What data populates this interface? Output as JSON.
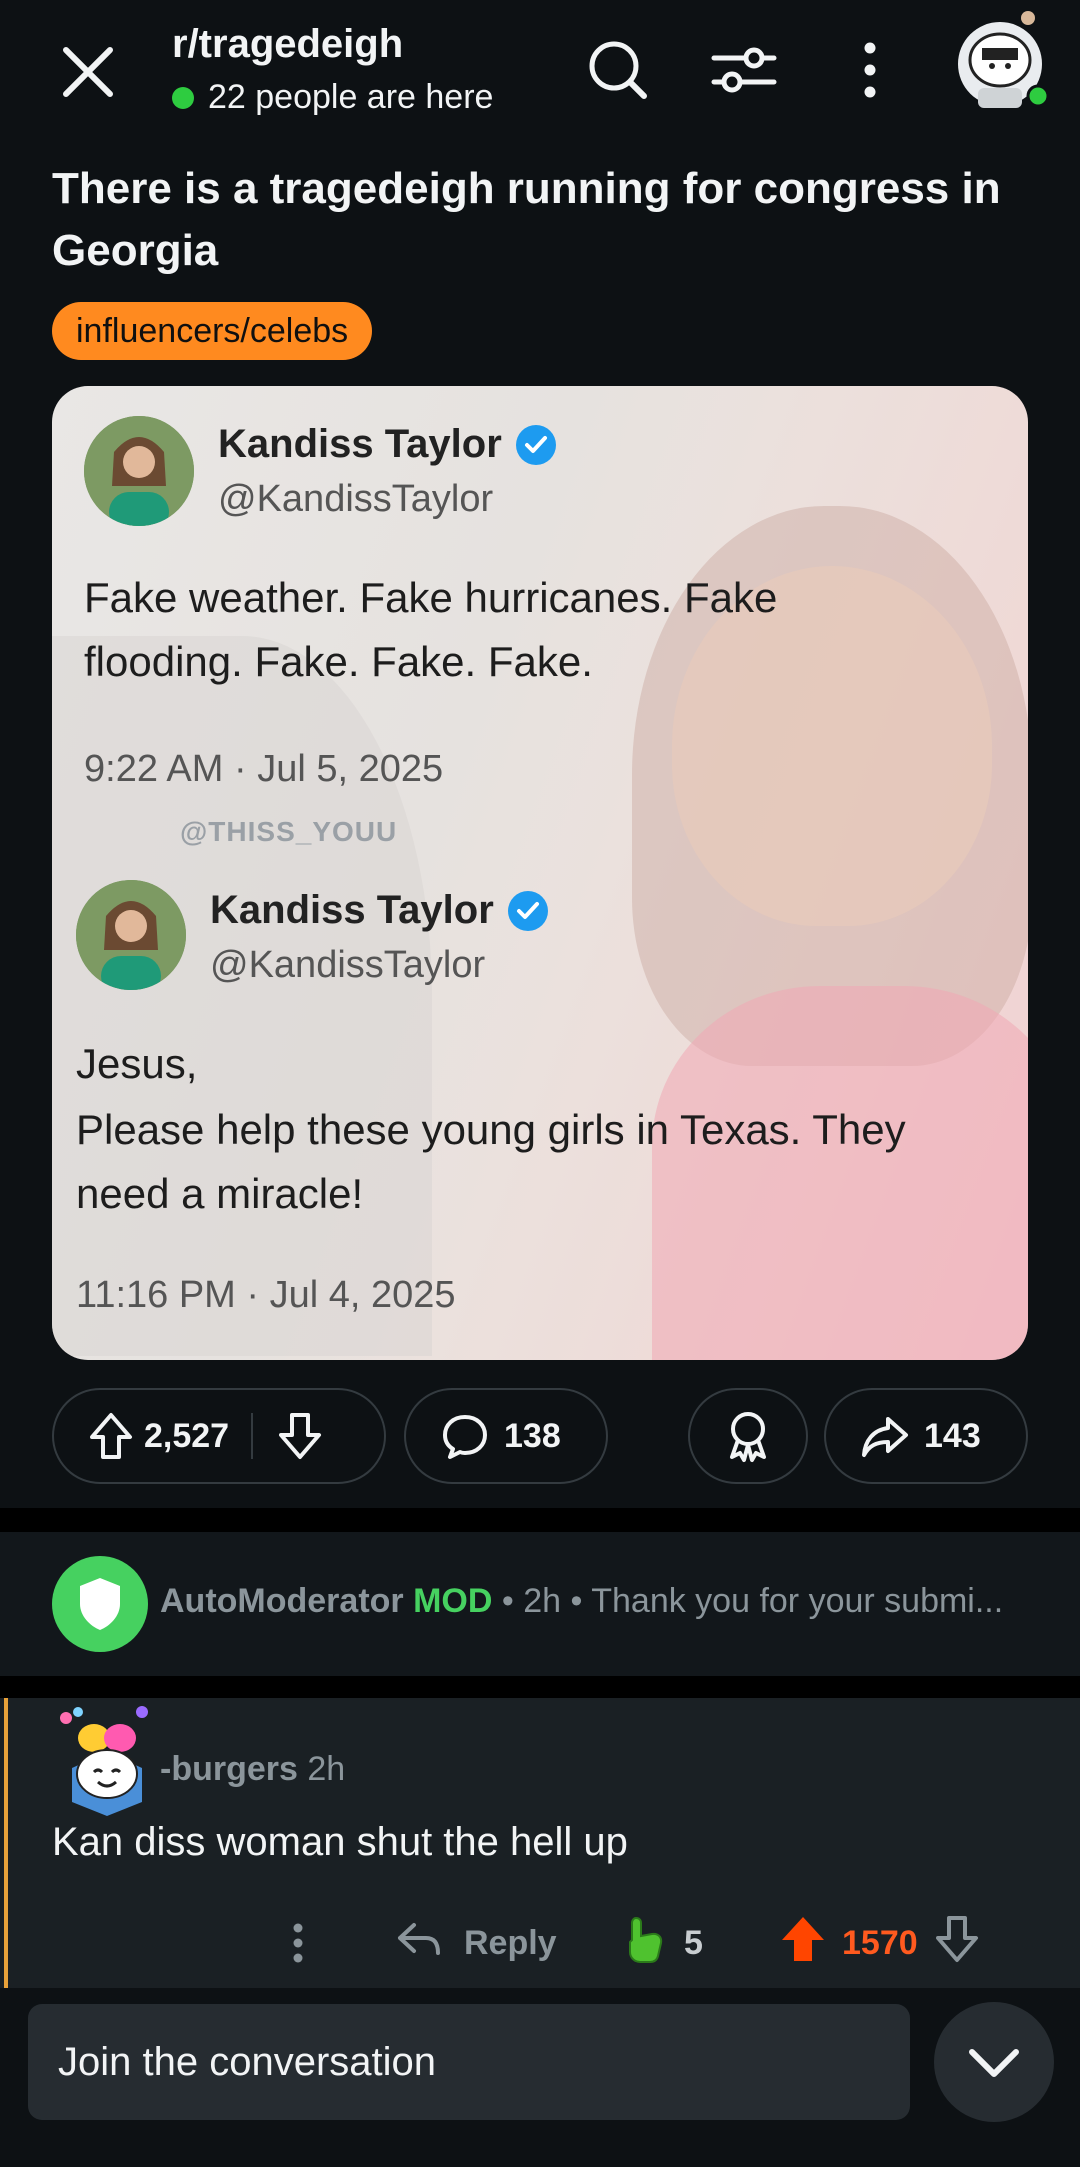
{
  "header": {
    "subreddit": "r/tragedeigh",
    "online_text": "22 people are here",
    "icons": [
      "close-icon",
      "search-icon",
      "filter-icon",
      "more-vertical-icon",
      "user-avatar"
    ]
  },
  "post": {
    "title": "There is a tragedeigh running for congress in Georgia",
    "flair": "influencers/celebs",
    "flair_color": "#ff8a1f"
  },
  "media": {
    "tweet1": {
      "name": "Kandiss Taylor",
      "handle": "@KandissTaylor",
      "text": "Fake weather. Fake hurricanes. Fake flooding. Fake. Fake. Fake.",
      "time": "9:22 AM · Jul 5, 2025"
    },
    "watermark": "@THISS_YOUU",
    "tweet2": {
      "name": "Kandiss Taylor",
      "handle": "@KandissTaylor",
      "text_line1": "Jesus,",
      "text_line2": "Please help these young girls in Texas. They need a miracle!",
      "time": "11:16 PM · Jul 4, 2025"
    }
  },
  "actions": {
    "upvotes": "2,527",
    "comments": "138",
    "shares": "143"
  },
  "automod": {
    "name": "AutoModerator",
    "badge": "MOD",
    "meta": " • 2h • Thank you for your submi...",
    "accent": "#46d160"
  },
  "comment": {
    "author": "-burgers",
    "age": "2h",
    "body": "Kan diss woman shut the hell up",
    "reply_label": "Reply",
    "award_count": "5",
    "score": "1570",
    "score_color": "#ff5a1f"
  },
  "composer": {
    "placeholder": "Join the conversation"
  }
}
